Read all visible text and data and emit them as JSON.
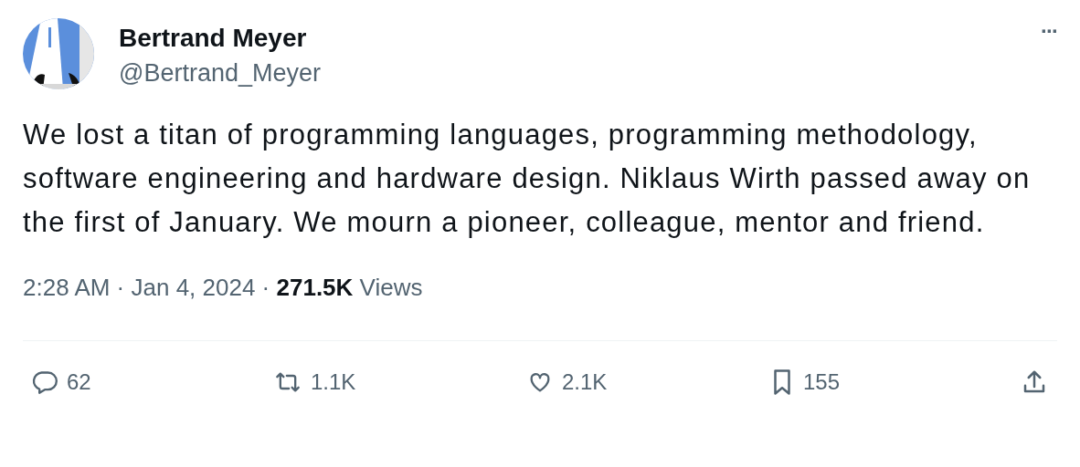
{
  "author": {
    "name": "Bertrand Meyer",
    "handle": "@Bertrand_Meyer"
  },
  "more": "···",
  "text": "We lost a titan of programming languages, programming methodology, software engineering and hardware design. Niklaus Wirth passed away on the first of January. We mourn a pioneer, colleague, mentor and friend.",
  "meta": "2:28 AM · Jan 4, 2024 · **271.5K** Views",
  "actions": [
    {
      "kind": "reply",
      "count": "62"
    },
    {
      "kind": "repost",
      "count": "1.1K"
    },
    {
      "kind": "like",
      "count": "2.1K"
    },
    {
      "kind": "bookmark",
      "count": "155"
    },
    {
      "kind": "share"
    }
  ]
}
